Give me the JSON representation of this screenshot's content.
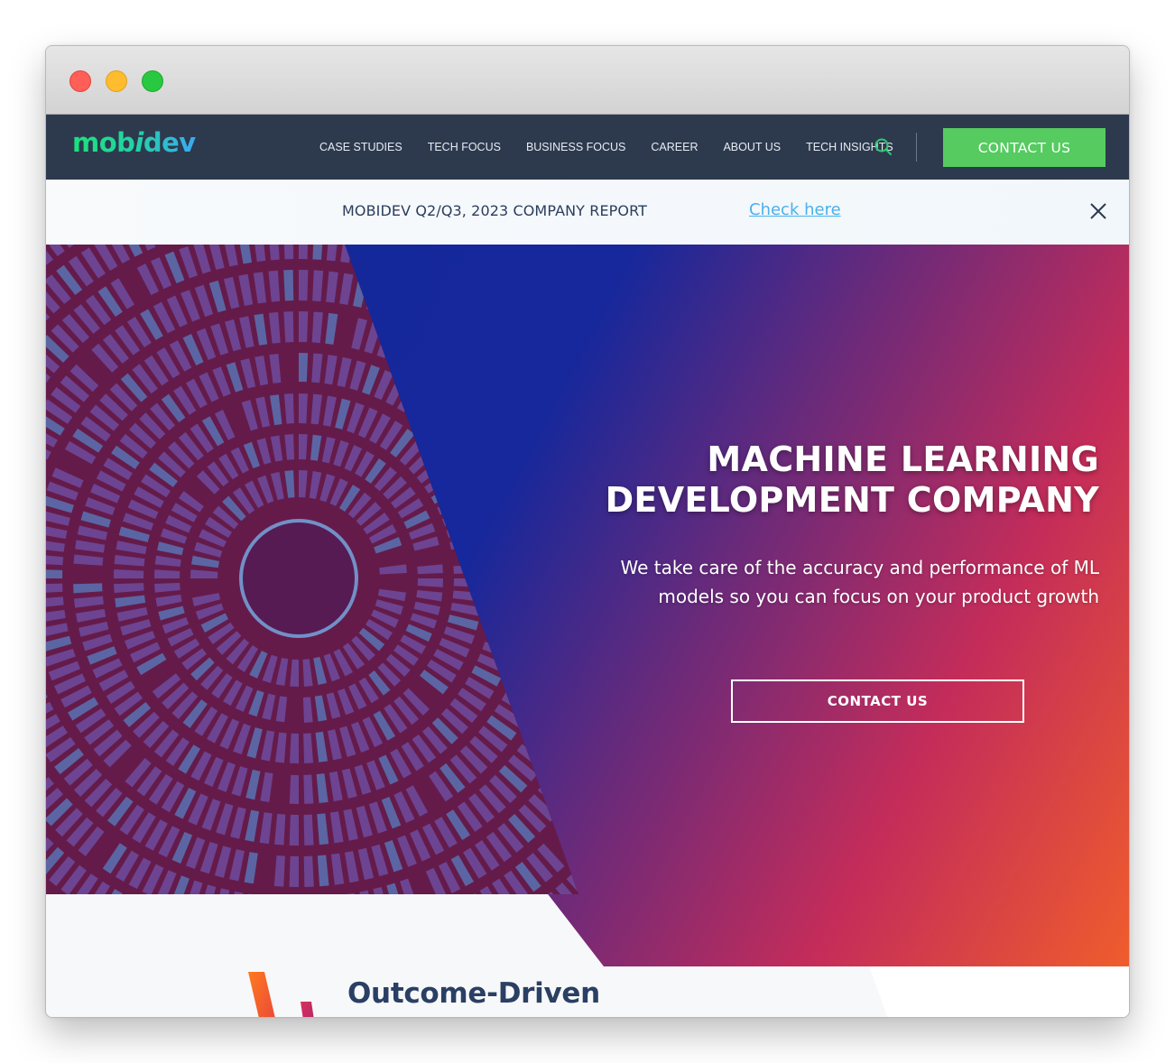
{
  "window": {
    "controls": [
      "close",
      "minimize",
      "maximize"
    ]
  },
  "navbar": {
    "logo": {
      "part1": "mob",
      "part2": "i",
      "part3": "dev"
    },
    "links": [
      "CASE STUDIES",
      "TECH FOCUS",
      "BUSINESS FOCUS",
      "CAREER",
      "ABOUT US",
      "TECH INSIGHTS"
    ],
    "search_icon": "search-icon",
    "contact_label": "CONTACT US"
  },
  "announcement": {
    "text": "MOBIDEV Q2/Q3, 2023 COMPANY REPORT",
    "link_label": "Check here",
    "close_icon": "close-icon"
  },
  "hero": {
    "title_line1": "MACHINE LEARNING",
    "title_line2": "DEVELOPMENT COMPANY",
    "subtitle": "We take care of the accuracy and performance of ML models so you can focus on your product growth",
    "cta_label": "CONTACT US"
  },
  "next_section": {
    "title": "Outcome-Driven"
  },
  "colors": {
    "nav_bg": "#2d3a4e",
    "cta_green": "#55cb60",
    "link_blue": "#4ab1ec",
    "heading_navy": "#2a3f63",
    "gradient_start": "#16289b",
    "gradient_mid": "#c42c5a",
    "gradient_end": "#ef5d2c"
  }
}
